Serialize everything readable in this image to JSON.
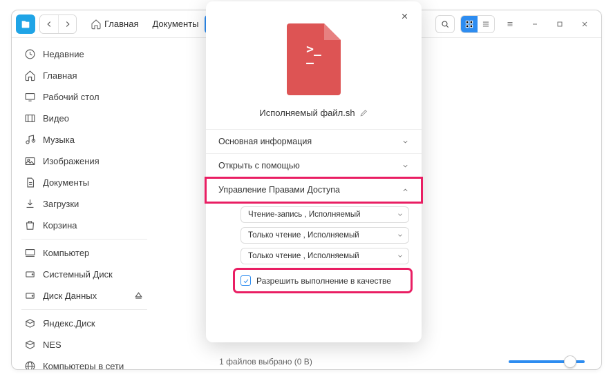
{
  "titlebar": {
    "breadcrumbs": [
      {
        "label": "Главная",
        "icon": "home"
      },
      {
        "label": "Документы",
        "icon": null
      },
      {
        "label": "",
        "icon": null,
        "active": true
      }
    ]
  },
  "sidebar": {
    "items": [
      {
        "label": "Недавние",
        "icon": "clock"
      },
      {
        "label": "Главная",
        "icon": "home"
      },
      {
        "label": "Рабочий стол",
        "icon": "desktop"
      },
      {
        "label": "Видео",
        "icon": "video"
      },
      {
        "label": "Музыка",
        "icon": "music"
      },
      {
        "label": "Изображения",
        "icon": "image"
      },
      {
        "label": "Документы",
        "icon": "document"
      },
      {
        "label": "Загрузки",
        "icon": "download"
      },
      {
        "label": "Корзина",
        "icon": "trash"
      }
    ],
    "devices": [
      {
        "label": "Компьютер",
        "icon": "computer",
        "eject": false
      },
      {
        "label": "Системный Диск",
        "icon": "disk",
        "eject": false
      },
      {
        "label": "Диск Данных",
        "icon": "disk",
        "eject": true
      }
    ],
    "network": [
      {
        "label": "Яндекс.Диск",
        "icon": "box"
      },
      {
        "label": "NES",
        "icon": "box"
      },
      {
        "label": "Компьютеры в сети",
        "icon": "globe"
      }
    ]
  },
  "panel": {
    "filename": "Исполняемый файл.sh",
    "sections": {
      "basic": "Основная информация",
      "open_with": "Открыть с помощью",
      "permissions": "Управление Правами Доступа"
    },
    "perm_rows": [
      "Чтение-запись , Исполняемый",
      "Только чтение , Исполняемый",
      "Только чтение , Исполняемый"
    ],
    "exec_label": "Разрешить выполнение в качестве"
  },
  "status": {
    "text": "1 файлов выбрано (0 B)"
  }
}
